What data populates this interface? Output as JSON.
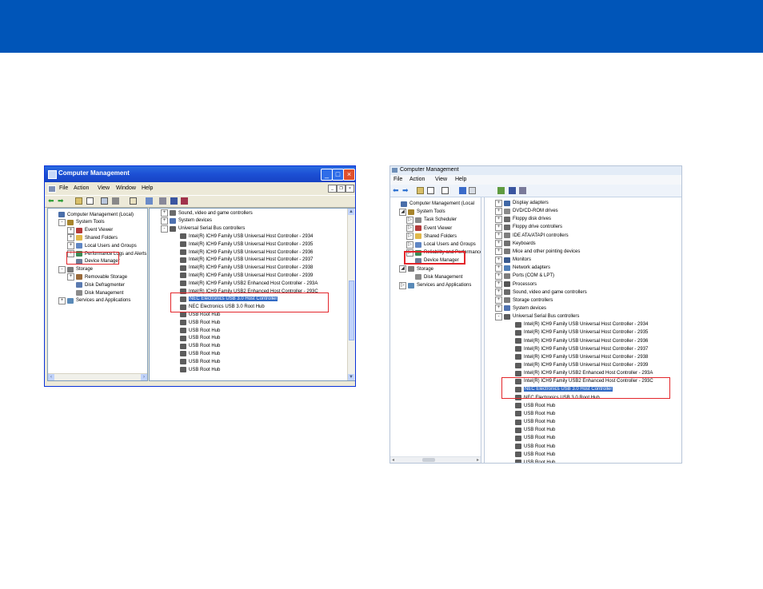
{
  "colors": {
    "banner": "#0055b8",
    "highlight": "#e3262b",
    "selection": "#316ac5"
  },
  "xp": {
    "title": "Computer Management",
    "menu": [
      "File",
      "Action",
      "View",
      "Window",
      "Help"
    ],
    "left_tree": [
      {
        "label": "Computer Management (Local)",
        "indent": 0,
        "exp": "",
        "icon": "computer-icon"
      },
      {
        "label": "System Tools",
        "indent": 1,
        "exp": "-",
        "icon": "tools-icon"
      },
      {
        "label": "Event Viewer",
        "indent": 2,
        "exp": "+",
        "icon": "event-viewer-icon"
      },
      {
        "label": "Shared Folders",
        "indent": 2,
        "exp": "+",
        "icon": "folder-icon"
      },
      {
        "label": "Local Users and Groups",
        "indent": 2,
        "exp": "+",
        "icon": "users-icon"
      },
      {
        "label": "Performance Logs and Alerts",
        "indent": 2,
        "exp": "+",
        "icon": "performance-icon"
      },
      {
        "label": "Device Manager",
        "indent": 2,
        "exp": "",
        "icon": "device-manager-icon"
      },
      {
        "label": "Storage",
        "indent": 1,
        "exp": "-",
        "icon": "storage-icon"
      },
      {
        "label": "Removable Storage",
        "indent": 2,
        "exp": "+",
        "icon": "removable-storage-icon"
      },
      {
        "label": "Disk Defragmenter",
        "indent": 2,
        "exp": "",
        "icon": "defrag-icon"
      },
      {
        "label": "Disk Management",
        "indent": 2,
        "exp": "",
        "icon": "disk-icon"
      },
      {
        "label": "Services and Applications",
        "indent": 1,
        "exp": "+",
        "icon": "services-icon"
      }
    ],
    "right_tree": [
      {
        "label": "Sound, video and game controllers",
        "indent": 0,
        "exp": "+",
        "icon": "sound-icon"
      },
      {
        "label": "System devices",
        "indent": 0,
        "exp": "+",
        "icon": "system-devices-icon"
      },
      {
        "label": "Universal Serial Bus controllers",
        "indent": 0,
        "exp": "-",
        "icon": "usb-icon"
      },
      {
        "label": "Intel(R) ICH9 Family USB Universal Host Controller - 2934",
        "indent": 1,
        "exp": "",
        "icon": "usb-icon"
      },
      {
        "label": "Intel(R) ICH9 Family USB Universal Host Controller - 2935",
        "indent": 1,
        "exp": "",
        "icon": "usb-icon"
      },
      {
        "label": "Intel(R) ICH9 Family USB Universal Host Controller - 2936",
        "indent": 1,
        "exp": "",
        "icon": "usb-icon"
      },
      {
        "label": "Intel(R) ICH9 Family USB Universal Host Controller - 2937",
        "indent": 1,
        "exp": "",
        "icon": "usb-icon"
      },
      {
        "label": "Intel(R) ICH9 Family USB Universal Host Controller - 2938",
        "indent": 1,
        "exp": "",
        "icon": "usb-icon"
      },
      {
        "label": "Intel(R) ICH9 Family USB Universal Host Controller - 2939",
        "indent": 1,
        "exp": "",
        "icon": "usb-icon"
      },
      {
        "label": "Intel(R) ICH9 Family USB2 Enhanced Host Controller - 293A",
        "indent": 1,
        "exp": "",
        "icon": "usb-icon"
      },
      {
        "label": "Intel(R) ICH9 Family USB2 Enhanced Host Controller - 293C",
        "indent": 1,
        "exp": "",
        "icon": "usb-icon"
      },
      {
        "label": "NEC Electronics USB 3.0 Host Controller",
        "indent": 1,
        "exp": "",
        "icon": "usb-icon",
        "selected": true
      },
      {
        "label": "NEC Electronics USB 3.0 Root Hub",
        "indent": 1,
        "exp": "",
        "icon": "usb-icon"
      },
      {
        "label": "USB Root Hub",
        "indent": 1,
        "exp": "",
        "icon": "usb-icon"
      },
      {
        "label": "USB Root Hub",
        "indent": 1,
        "exp": "",
        "icon": "usb-icon"
      },
      {
        "label": "USB Root Hub",
        "indent": 1,
        "exp": "",
        "icon": "usb-icon"
      },
      {
        "label": "USB Root Hub",
        "indent": 1,
        "exp": "",
        "icon": "usb-icon"
      },
      {
        "label": "USB Root Hub",
        "indent": 1,
        "exp": "",
        "icon": "usb-icon"
      },
      {
        "label": "USB Root Hub",
        "indent": 1,
        "exp": "",
        "icon": "usb-icon"
      },
      {
        "label": "USB Root Hub",
        "indent": 1,
        "exp": "",
        "icon": "usb-icon"
      },
      {
        "label": "USB Root Hub",
        "indent": 1,
        "exp": "",
        "icon": "usb-icon"
      }
    ]
  },
  "win7": {
    "title": "Computer Management",
    "menu": [
      "File",
      "Action",
      "View",
      "Help"
    ],
    "left_tree": [
      {
        "label": "Computer Management (Local",
        "indent": 0,
        "exp": "",
        "icon": "computer-icon"
      },
      {
        "label": "System Tools",
        "indent": 1,
        "exp": "◢",
        "icon": "tools-icon"
      },
      {
        "label": "Task Scheduler",
        "indent": 2,
        "exp": "▷",
        "icon": "task-scheduler-icon"
      },
      {
        "label": "Event Viewer",
        "indent": 2,
        "exp": "▷",
        "icon": "event-viewer-icon"
      },
      {
        "label": "Shared Folders",
        "indent": 2,
        "exp": "▷",
        "icon": "folder-icon"
      },
      {
        "label": "Local Users and Groups",
        "indent": 2,
        "exp": "▷",
        "icon": "users-icon"
      },
      {
        "label": "Reliability and Performance",
        "indent": 2,
        "exp": "▷",
        "icon": "performance-icon"
      },
      {
        "label": "Device Manager",
        "indent": 2,
        "exp": "",
        "icon": "device-manager-icon"
      },
      {
        "label": "Storage",
        "indent": 1,
        "exp": "◢",
        "icon": "storage-icon"
      },
      {
        "label": "Disk Management",
        "indent": 2,
        "exp": "",
        "icon": "disk-icon"
      },
      {
        "label": "Services and Applications",
        "indent": 1,
        "exp": "▷",
        "icon": "services-icon"
      }
    ],
    "right_tree": [
      {
        "label": "Display adapters",
        "indent": 0,
        "exp": "+",
        "icon": "display-icon"
      },
      {
        "label": "DVD/CD-ROM drives",
        "indent": 0,
        "exp": "+",
        "icon": "dvd-icon"
      },
      {
        "label": "Floppy disk drives",
        "indent": 0,
        "exp": "+",
        "icon": "floppy-icon"
      },
      {
        "label": "Floppy drive controllers",
        "indent": 0,
        "exp": "+",
        "icon": "floppy-icon"
      },
      {
        "label": "IDE ATA/ATAPI controllers",
        "indent": 0,
        "exp": "+",
        "icon": "ide-icon"
      },
      {
        "label": "Keyboards",
        "indent": 0,
        "exp": "+",
        "icon": "keyboard-icon"
      },
      {
        "label": "Mice and other pointing devices",
        "indent": 0,
        "exp": "+",
        "icon": "mouse-icon"
      },
      {
        "label": "Monitors",
        "indent": 0,
        "exp": "+",
        "icon": "monitor-icon"
      },
      {
        "label": "Network adapters",
        "indent": 0,
        "exp": "+",
        "icon": "network-icon"
      },
      {
        "label": "Ports (COM & LPT)",
        "indent": 0,
        "exp": "+",
        "icon": "port-icon"
      },
      {
        "label": "Processors",
        "indent": 0,
        "exp": "+",
        "icon": "processor-icon"
      },
      {
        "label": "Sound, video and game controllers",
        "indent": 0,
        "exp": "+",
        "icon": "sound-icon"
      },
      {
        "label": "Storage controllers",
        "indent": 0,
        "exp": "+",
        "icon": "storage-icon"
      },
      {
        "label": "System devices",
        "indent": 0,
        "exp": "+",
        "icon": "system-devices-icon"
      },
      {
        "label": "Universal Serial Bus controllers",
        "indent": 0,
        "exp": "-",
        "icon": "usb-icon"
      },
      {
        "label": "Intel(R) ICH9 Family USB Universal Host Controller - 2934",
        "indent": 1,
        "exp": "",
        "icon": "usb-icon"
      },
      {
        "label": "Intel(R) ICH9 Family USB Universal Host Controller - 2935",
        "indent": 1,
        "exp": "",
        "icon": "usb-icon"
      },
      {
        "label": "Intel(R) ICH9 Family USB Universal Host Controller - 2936",
        "indent": 1,
        "exp": "",
        "icon": "usb-icon"
      },
      {
        "label": "Intel(R) ICH9 Family USB Universal Host Controller - 2937",
        "indent": 1,
        "exp": "",
        "icon": "usb-icon"
      },
      {
        "label": "Intel(R) ICH9 Family USB Universal Host Controller - 2938",
        "indent": 1,
        "exp": "",
        "icon": "usb-icon"
      },
      {
        "label": "Intel(R) ICH9 Family USB Universal Host Controller - 2939",
        "indent": 1,
        "exp": "",
        "icon": "usb-icon"
      },
      {
        "label": "Intel(R) ICH9 Family USB2 Enhanced Host Controller - 293A",
        "indent": 1,
        "exp": "",
        "icon": "usb-icon"
      },
      {
        "label": "Intel(R) ICH9 Family USB2 Enhanced Host Controller - 293C",
        "indent": 1,
        "exp": "",
        "icon": "usb-icon"
      },
      {
        "label": "NEC Electronics USB 3.0 Host Controller",
        "indent": 1,
        "exp": "",
        "icon": "usb-icon",
        "selected": true
      },
      {
        "label": "NEC Electronics USB 3.0 Root Hub",
        "indent": 1,
        "exp": "",
        "icon": "usb-icon"
      },
      {
        "label": "USB Root Hub",
        "indent": 1,
        "exp": "",
        "icon": "usb-icon"
      },
      {
        "label": "USB Root Hub",
        "indent": 1,
        "exp": "",
        "icon": "usb-icon"
      },
      {
        "label": "USB Root Hub",
        "indent": 1,
        "exp": "",
        "icon": "usb-icon"
      },
      {
        "label": "USB Root Hub",
        "indent": 1,
        "exp": "",
        "icon": "usb-icon"
      },
      {
        "label": "USB Root Hub",
        "indent": 1,
        "exp": "",
        "icon": "usb-icon"
      },
      {
        "label": "USB Root Hub",
        "indent": 1,
        "exp": "",
        "icon": "usb-icon"
      },
      {
        "label": "USB Root Hub",
        "indent": 1,
        "exp": "",
        "icon": "usb-icon"
      },
      {
        "label": "USB Root Hub",
        "indent": 1,
        "exp": "",
        "icon": "usb-icon"
      }
    ]
  }
}
